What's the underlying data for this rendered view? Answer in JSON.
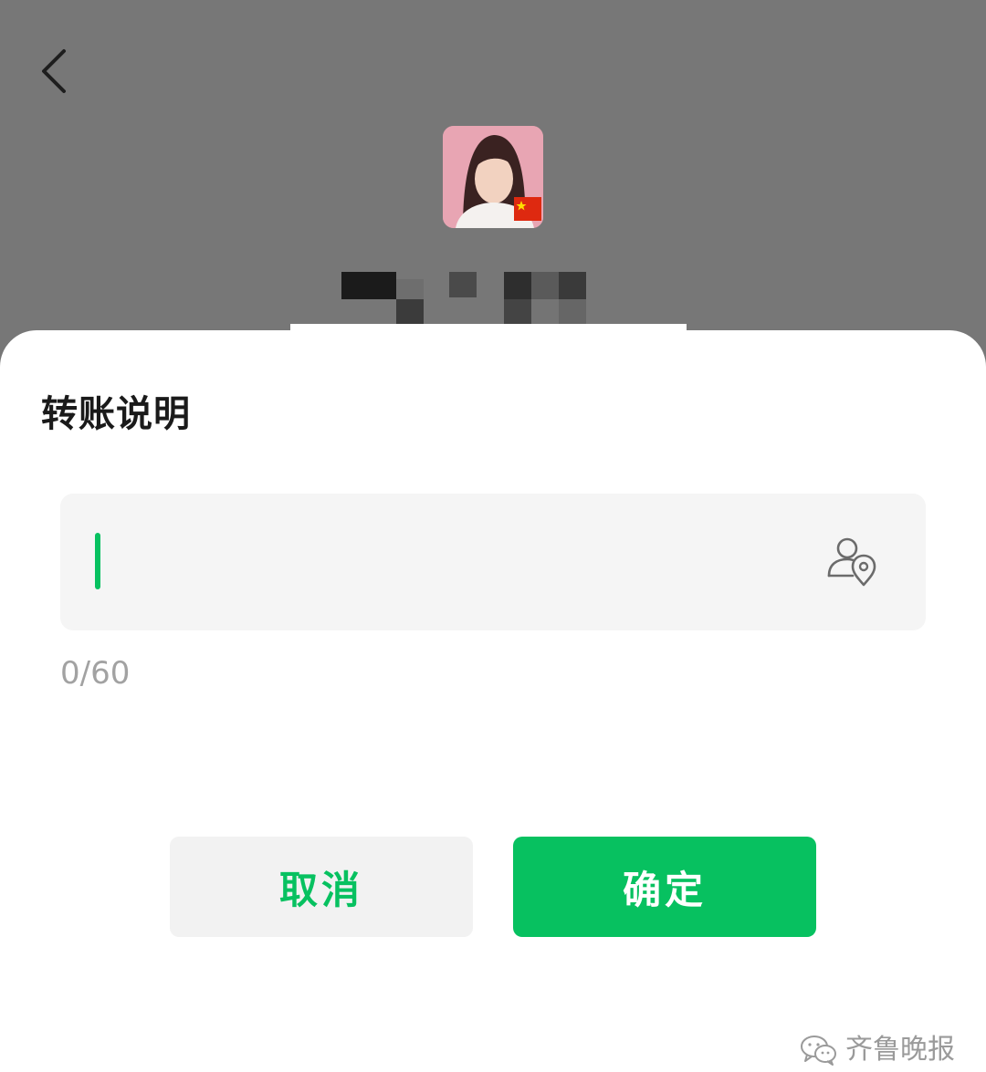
{
  "header": {
    "back_icon": "chevron-left-icon"
  },
  "dialog": {
    "title": "转账说明",
    "input": {
      "value": "",
      "mention_icon": "user-location-icon"
    },
    "char_count": "0/60",
    "cancel_label": "取消",
    "confirm_label": "确定"
  },
  "watermark": {
    "text": "齐鲁晚报"
  },
  "colors": {
    "accent": "#07c160",
    "overlay": "#777777",
    "input_bg": "#f5f5f5"
  }
}
